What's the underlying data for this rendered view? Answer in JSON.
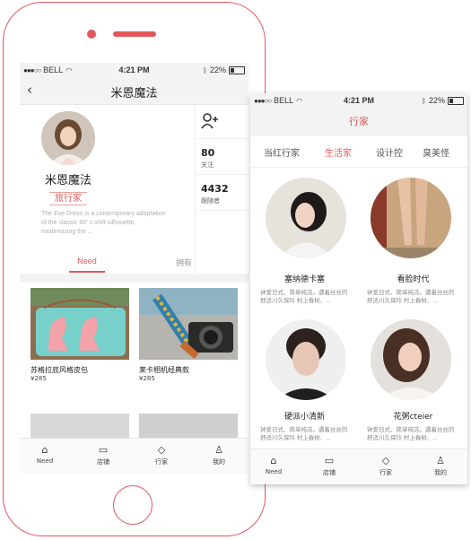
{
  "screen1": {
    "status": {
      "carrier": "BELL",
      "time": "4:21 PM",
      "battery": "22%"
    },
    "nav": {
      "title": "米恩魔法",
      "back_icon": "chevron-left-icon"
    },
    "profile": {
      "name": "米恩魔法",
      "tag": "旅行家",
      "description": "The Eve Dress is a contemporary adaptation of the classic 60' s shift silhouette, modernizing the ..."
    },
    "stats": [
      {
        "num": "80",
        "label": "关注"
      },
      {
        "num": "4432",
        "label": "跟随者"
      }
    ],
    "segments": [
      "Need",
      "拥有"
    ],
    "products": [
      {
        "name": "苏格拉底风格皮包",
        "price": "¥285"
      },
      {
        "name": "莱卡相机经典款",
        "price": "¥285"
      }
    ],
    "tabs": [
      "Need",
      "店铺",
      "行家",
      "我的"
    ]
  },
  "screen2": {
    "status": {
      "carrier": "BELL",
      "time": "4:21 PM",
      "battery": "22%"
    },
    "title": "行家",
    "categories": [
      "当红行家",
      "生活家",
      "设计控",
      "臭美怪"
    ],
    "people": [
      {
        "name": "塞纳德卡塞",
        "desc": "钟爱日式、简单纯洁。遇着丝丝的舒适川久保玲 村上春树、..."
      },
      {
        "name": "看脸时代",
        "desc": "钟爱日式、简单纯洁。遇着丝丝的舒适川久保玲 村上春树、..."
      },
      {
        "name": "硬派小清新",
        "desc": "钟爱日式、简单纯洁。遇着丝丝的舒适川久保玲 村上春树、..."
      },
      {
        "name": "花粥cteier",
        "desc": "钟爱日式、简单纯洁。遇着丝丝的舒适川久保玲 村上春树、..."
      }
    ],
    "tabs": [
      "Need",
      "店铺",
      "行家",
      "我的"
    ]
  },
  "colors": {
    "accent": "#e2585a",
    "background": "#ffffff",
    "bar": "#f3f3f3"
  }
}
